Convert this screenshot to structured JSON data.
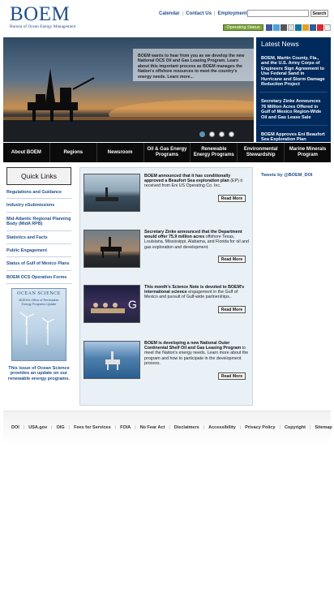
{
  "header": {
    "logo_main": "BOEM",
    "logo_sub": "Bureau of Ocean Energy Management",
    "top_links": [
      "Calendar",
      "Contact Us",
      "Employment"
    ],
    "search_button": "Search",
    "operating_status": "Operating Status",
    "social_icons": [
      "facebook-icon",
      "twitter-icon",
      "youtube-icon",
      "flickr-icon",
      "linkedin-icon",
      "rss-icon",
      "email-icon",
      "youtube-icon",
      "more-icon"
    ]
  },
  "hero": {
    "promo_text": "BOEM wants to hear from you as we develop the new National OCS Oil and Gas Leasing Program. Learn about this important process as BOEM manages the Nation's offshore resources to meet the country's energy needs.",
    "promo_link": "Learn more...",
    "slides": 4,
    "active_slide": 0
  },
  "latest_news": {
    "title": "Latest News",
    "items": [
      "BOEM, Martin County, Fla., and the U.S. Army Corps of Engineers Sign Agreement to Use Federal Sand in Hurricane and Storm Damage Reduction Project",
      "Secretary Zinke Announces 76 Million Acres Offered in Gulf of Mexico Region-Wide Oil and Gas Lease Sale",
      "BOEM Approves Eni Beaufort Sea Exploration Plan"
    ]
  },
  "nav": [
    "About BOEM",
    "Regions",
    "Newsroom",
    "Oil & Gas Energy Programs",
    "Renewable Energy Programs",
    "Environmental Stewardship",
    "Marine Minerals Program"
  ],
  "sidebar": {
    "quick_links_title": "Quick Links",
    "links": [
      "Regulations and Guidance",
      "Industry eSubmissions",
      "Mid-Atlantic Regional Planning Body (MidA RPB)",
      "Statistics and Facts",
      "Public Engagement",
      "Status of Gulf of Mexico Plans",
      "BOEM OCS Operation Forms"
    ],
    "ocean_science_title": "OCEAN SCIENCE",
    "ocean_science_sub": "BOEM's Office of Renewable Energy Programs Update",
    "ocean_science_caption": "This issue of Ocean Science provides an update on our renewable energy programs."
  },
  "stories": [
    {
      "bold": "BOEM announced that it has conditionally approved a Beaufort Sea exploration plan",
      "rest": " (EP) it received from Eni US Operating Co. Inc.",
      "button": "Read More"
    },
    {
      "bold": "Secretary Zinke announced that the Department would offer 75.9 million acres",
      "rest": " offshore Texas, Louisiana, Mississippi, Alabama, and Florida for oil and gas exploration and development.",
      "button": "Read More"
    },
    {
      "bold": "This month's Science Note is devoted to BOEM's international science",
      "rest": " engagement in the Gulf of Mexico and pursuit of Gulf-wide partnerships..",
      "button": "Read More"
    },
    {
      "bold": "BOEM is developing a new National Outer Continental Shelf Oil and Gas Leasing Program",
      "rest": " to meet the Nation's energy needs. Learn more about the program and how to participate in the development process.",
      "button": "Read More"
    }
  ],
  "tweets_link": "Tweets by @BOEM_DOI",
  "footer_links": [
    "DOI",
    "USA.gov",
    "OIG",
    "Fees for Services",
    "FOIA",
    "No Fear Act",
    "Disclaimers",
    "Accessibility",
    "Privacy Policy",
    "Copyright",
    "Sitemap"
  ],
  "colors": {
    "brand_blue": "#1f4e8c",
    "news_panel": "#002a5c",
    "nav_bar": "#0b0b0b",
    "status_green": "#7aa33b"
  }
}
